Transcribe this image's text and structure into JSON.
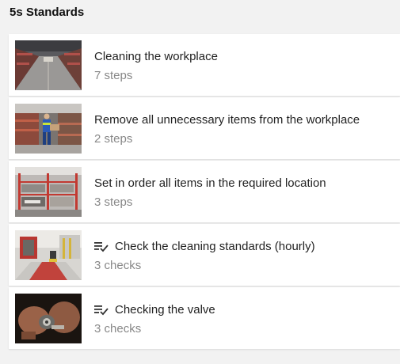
{
  "section": {
    "title": "5s Standards"
  },
  "items": [
    {
      "title": "Cleaning the workplace",
      "subtitle": "7 steps",
      "thumbnail": "warehouse-aisle",
      "type": "steps"
    },
    {
      "title": "Remove all unnecessary items from the workplace",
      "subtitle": "2 steps",
      "thumbnail": "worker-at-shelves",
      "type": "steps"
    },
    {
      "title": "Set in order all items in the required location",
      "subtitle": "3 steps",
      "thumbnail": "red-racking",
      "type": "steps"
    },
    {
      "title": "Check the cleaning standards (hourly)",
      "subtitle": "3 checks",
      "thumbnail": "forklift-hall",
      "type": "checklist",
      "icon": "checklist-icon"
    },
    {
      "title": "Checking the valve",
      "subtitle": "3 checks",
      "thumbnail": "hands-valve",
      "type": "checklist",
      "icon": "checklist-icon"
    }
  ]
}
